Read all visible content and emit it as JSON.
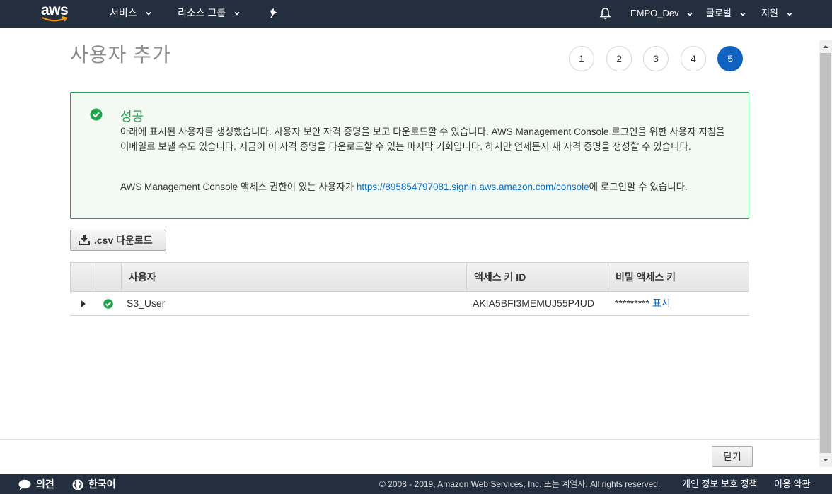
{
  "nav": {
    "logo": "aws",
    "services": "서비스",
    "resource_groups": "리소스 그룹",
    "pin_icon": "pin-icon",
    "bell_icon": "bell-icon",
    "account": "EMPO_Dev",
    "region": "글로벌",
    "support": "지원"
  },
  "page": {
    "title": "사용자 추가",
    "steps": [
      "1",
      "2",
      "3",
      "4",
      "5"
    ],
    "active_step": "5"
  },
  "success": {
    "title": "성공",
    "message": "아래에 표시된 사용자를 생성했습니다. 사용자 보안 자격 증명을 보고 다운로드할 수 있습니다. AWS Management Console 로그인을 위한 사용자 지침을 이메일로 보낼 수도 있습니다. 지금이 이 자격 증명을 다운로드할 수 있는 마지막 기회입니다. 하지만 언제든지 새 자격 증명을 생성할 수 있습니다.",
    "console_prefix": "AWS Management Console 액세스 권한이 있는 사용자가 ",
    "console_link": "https://895854797081.signin.aws.amazon.com/console",
    "console_suffix": "에 로그인할 수 있습니다."
  },
  "csv_button": ".csv 다운로드",
  "table": {
    "columns": [
      "사용자",
      "액세스 키 ID",
      "비밀 액세스 키"
    ],
    "rows": [
      {
        "user": "S3_User",
        "access_key_id": "AKIA5BFI3MEMUJ55P4UD",
        "secret_mask": "*********",
        "show_label": "표시"
      }
    ]
  },
  "close_button": "닫기",
  "footer": {
    "feedback": "의견",
    "language": "한국어",
    "copyright": "© 2008 - 2019, Amazon Web Services, Inc. 또는 계열사. All rights reserved.",
    "privacy": "개인 정보 보호 정책",
    "terms": "이용 약관"
  },
  "colors": {
    "nav_bg": "#232f3e",
    "accent": "#0f62c0",
    "success": "#21a34d",
    "link": "#0b6bbf"
  }
}
